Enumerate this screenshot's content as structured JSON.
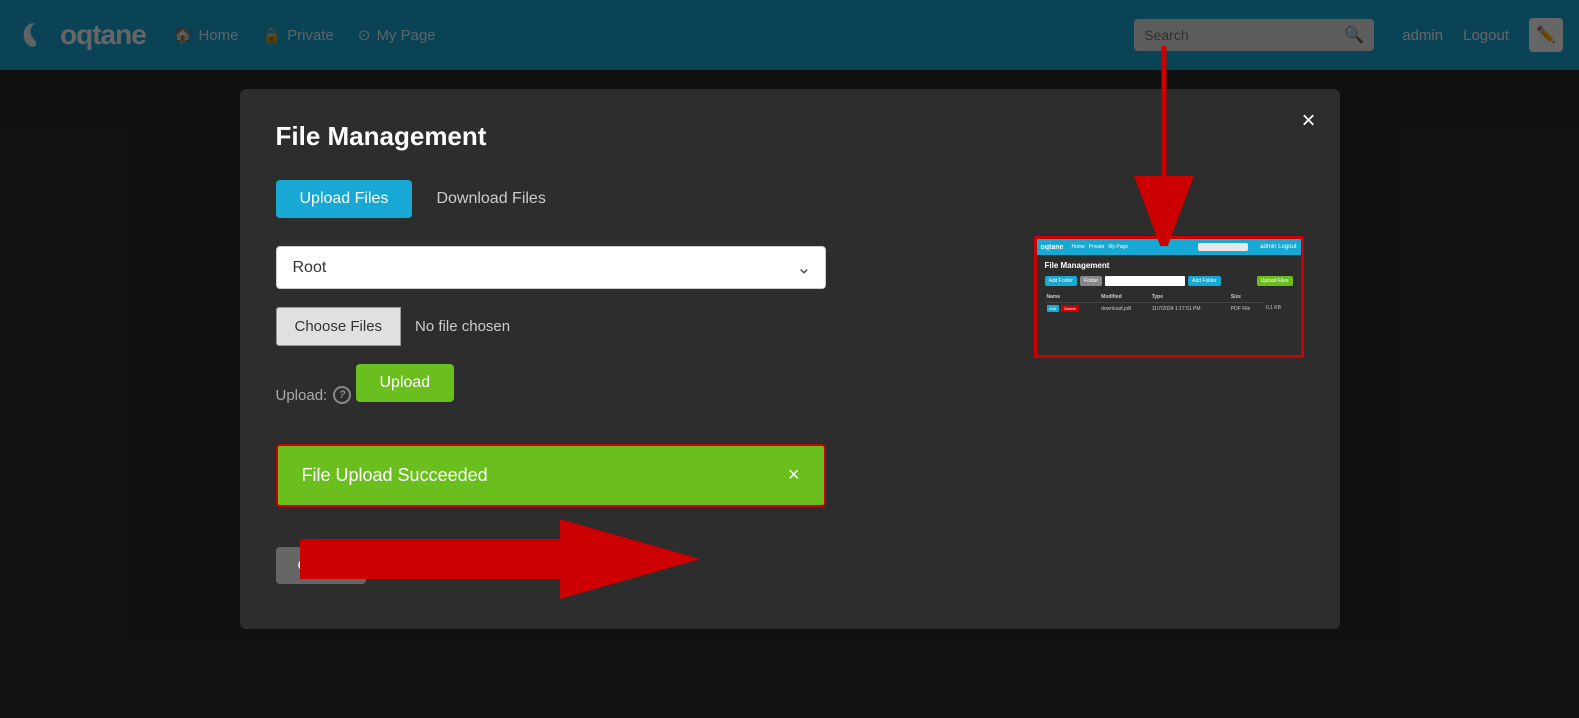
{
  "app": {
    "name": "oqtane"
  },
  "topnav": {
    "home_label": "Home",
    "private_label": "Private",
    "mypage_label": "My Page",
    "search_placeholder": "Search",
    "admin_label": "admin",
    "logout_label": "Logout"
  },
  "modal": {
    "title": "File Management",
    "close_label": "×",
    "tab_upload": "Upload Files",
    "tab_download": "Download Files",
    "folder_label": "Root",
    "folder_placeholder": "Root",
    "upload_label": "Upload:",
    "choose_files_label": "Choose Files",
    "no_file_label": "No file chosen",
    "upload_btn_label": "Upload",
    "success_message": "File Upload Succeeded",
    "success_close": "×",
    "cancel_label": "Cancel"
  },
  "preview": {
    "title": "File Management",
    "toolbar": {
      "btn1": "Add Folder",
      "btn2": "Folder",
      "input_placeholder": "",
      "btn3": "Add Folder",
      "btn_upload": "Upload Files"
    },
    "table": {
      "headers": [
        "Name",
        "Modified",
        "Type",
        "Size"
      ],
      "row": {
        "name": "download.pdf",
        "modified": "11/7/2024 1:17:51 PM",
        "type": "PDF File",
        "size": "0.1 KB"
      }
    }
  },
  "colors": {
    "accent_blue": "#17a8d4",
    "success_green": "#6abf1e",
    "danger_red": "#cc0000",
    "modal_bg": "#2d2d2d"
  }
}
